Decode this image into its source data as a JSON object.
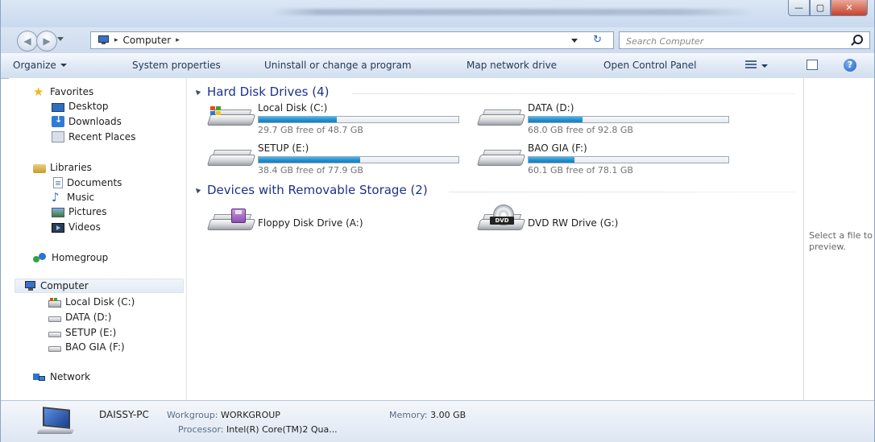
{
  "window": {
    "controls": {
      "minimize": "—",
      "maximize": "▢",
      "close": "✕"
    }
  },
  "address": {
    "crumb_sep": "▸",
    "location": "Computer",
    "refresh_glyph": "↻",
    "search_placeholder": "Search Computer"
  },
  "toolbar": {
    "organize": "Organize",
    "system_properties": "System properties",
    "uninstall": "Uninstall or change a program",
    "map_drive": "Map network drive",
    "control_panel": "Open Control Panel",
    "help_glyph": "?"
  },
  "sidebar": {
    "favorites": "Favorites",
    "desktop": "Desktop",
    "downloads": "Downloads",
    "recent": "Recent Places",
    "libraries": "Libraries",
    "documents": "Documents",
    "music": "Music",
    "pictures": "Pictures",
    "videos": "Videos",
    "homegroup": "Homegroup",
    "computer": "Computer",
    "drive_c": "Local Disk (C:)",
    "drive_d": "DATA (D:)",
    "drive_e": "SETUP (E:)",
    "drive_f": "BAO GIA (F:)",
    "network": "Network"
  },
  "groups": {
    "hdd": "Hard Disk Drives (4)",
    "removable": "Devices with Removable Storage (2)"
  },
  "drives": [
    {
      "name": "Local Disk (C:)",
      "free": "29.7 GB free of 48.7 GB",
      "used_fraction": 0.39
    },
    {
      "name": "DATA (D:)",
      "free": "68.0 GB free of 92.8 GB",
      "used_fraction": 0.27
    },
    {
      "name": "SETUP (E:)",
      "free": "38.4 GB free of 77.9 GB",
      "used_fraction": 0.51
    },
    {
      "name": "BAO GIA (F:)",
      "free": "60.1 GB free of 78.1 GB",
      "used_fraction": 0.23
    }
  ],
  "removable": [
    {
      "name": "Floppy Disk Drive (A:)"
    },
    {
      "name": "DVD RW Drive (G:)",
      "badge": "DVD"
    }
  ],
  "preview": {
    "message": "Select a file to preview."
  },
  "details": {
    "pc_name": "DAISSY-PC",
    "workgroup_label": "Workgroup:",
    "workgroup": "WORKGROUP",
    "memory_label": "Memory:",
    "memory": "3.00 GB",
    "processor_label": "Processor:",
    "processor": "Intel(R) Core(TM)2 Qua..."
  },
  "colors": {
    "accent": "#1f8fd0",
    "group_heading": "#1e3287",
    "toolbar_text": "#1e395b"
  },
  "icons": [
    "star-icon",
    "desktop-icon",
    "downloads-icon",
    "recent-places-icon",
    "library-icon",
    "documents-icon",
    "music-icon",
    "pictures-icon",
    "videos-icon",
    "homegroup-icon",
    "computer-icon",
    "hard-drive-icon",
    "floppy-icon",
    "dvd-icon",
    "network-icon",
    "search-icon",
    "help-icon"
  ]
}
